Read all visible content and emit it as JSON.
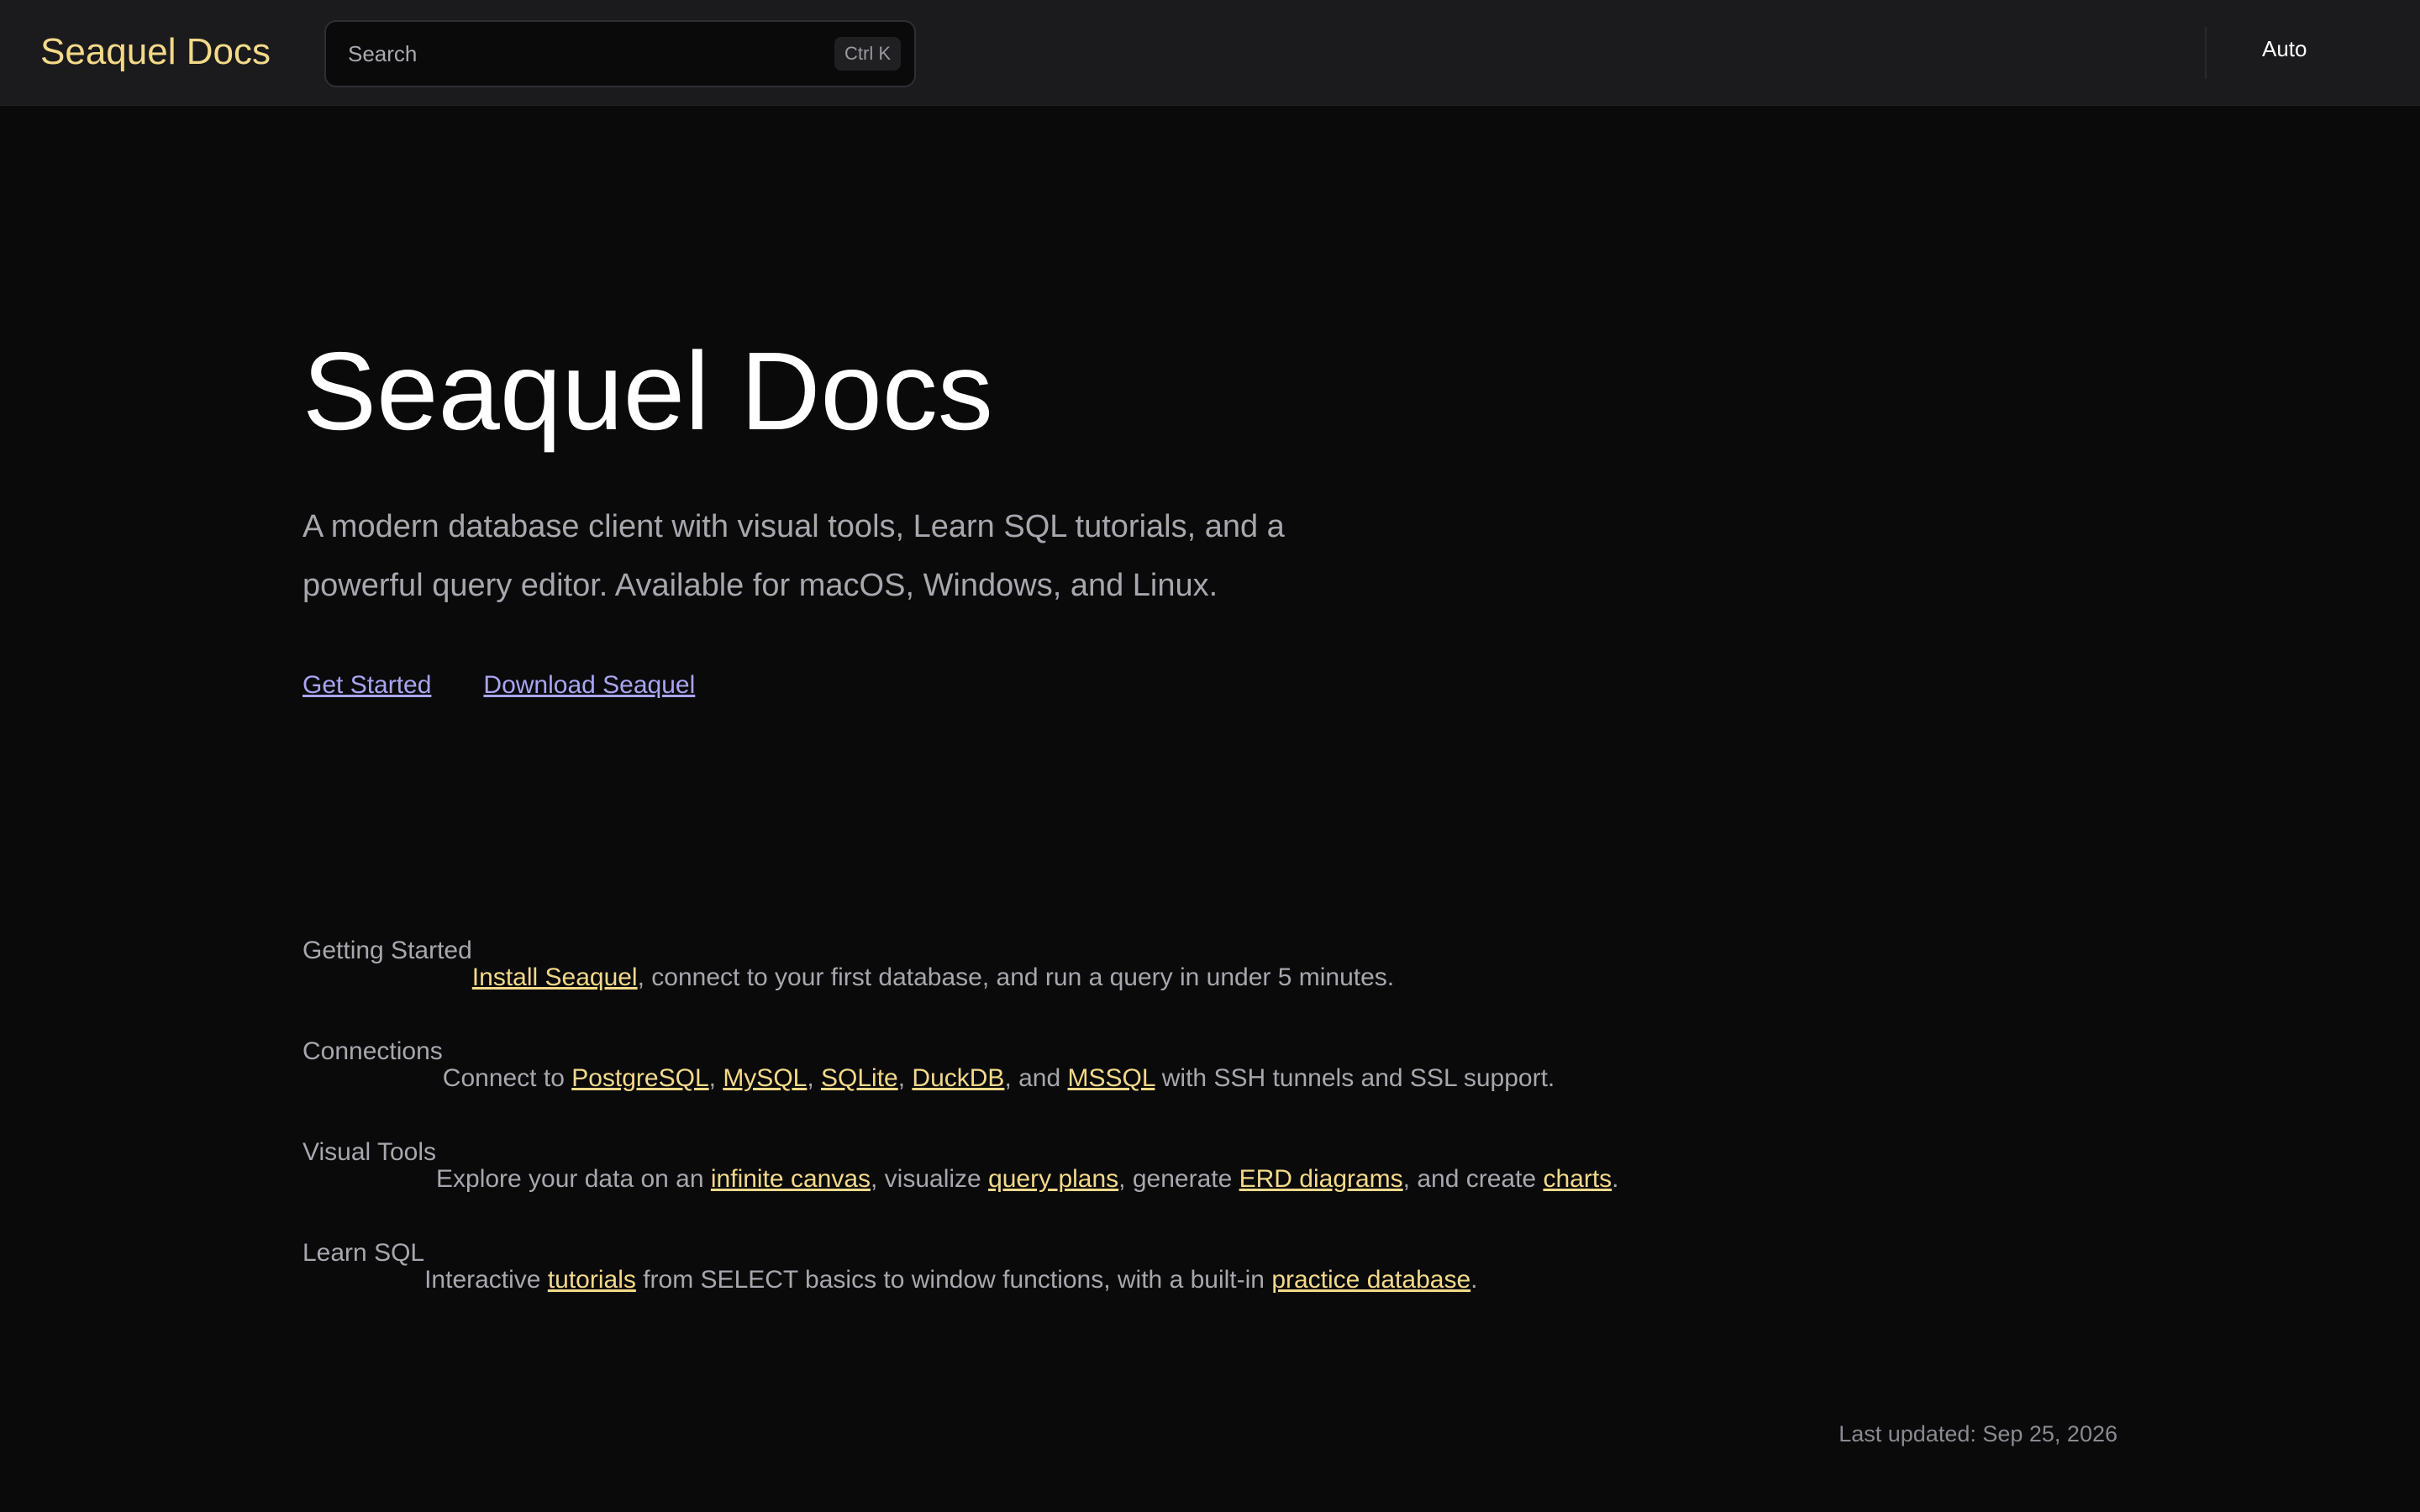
{
  "header": {
    "brand": "Seaquel Docs",
    "search_placeholder": "Search",
    "search_shortcut": "Ctrl K",
    "theme": "Auto"
  },
  "hero": {
    "title": "Seaquel Docs",
    "subtitle": "A modern database client with visual tools, Learn SQL tutorials, and a powerful query editor. Available for macOS, Windows, and Linux.",
    "links": [
      "Get Started",
      "Download Seaquel"
    ]
  },
  "features": [
    {
      "title": "Getting Started",
      "parts": [
        {
          "link": "Install Seaquel"
        },
        {
          "text": ", connect to your first database, and run a query in under 5 minutes."
        }
      ]
    },
    {
      "title": "Connections",
      "parts": [
        {
          "text": "Connect to "
        },
        {
          "link": "PostgreSQL"
        },
        {
          "text": ", "
        },
        {
          "link": "MySQL"
        },
        {
          "text": ", "
        },
        {
          "link": "SQLite"
        },
        {
          "text": ", "
        },
        {
          "link": "DuckDB"
        },
        {
          "text": ", and "
        },
        {
          "link": "MSSQL"
        },
        {
          "text": " with SSH tunnels and SSL support."
        }
      ]
    },
    {
      "title": "Visual Tools",
      "parts": [
        {
          "text": "Explore your data on an "
        },
        {
          "link": "infinite canvas"
        },
        {
          "text": ", visualize "
        },
        {
          "link": "query plans"
        },
        {
          "text": ", generate "
        },
        {
          "link": "ERD diagrams"
        },
        {
          "text": ", and create "
        },
        {
          "link": "charts"
        },
        {
          "text": "."
        }
      ]
    },
    {
      "title": "Learn SQL",
      "parts": [
        {
          "text": "Interactive "
        },
        {
          "link": "tutorials"
        },
        {
          "text": " from SELECT basics to window functions, with a built-in "
        },
        {
          "link": "practice database"
        },
        {
          "text": "."
        }
      ]
    }
  ],
  "footer": {
    "last_updated": "Last updated: Sep 25, 2026"
  },
  "colors": {
    "background": "#0a0a0b",
    "header": "#1b1b1d",
    "brand": "#f4d98a",
    "hero_link": "#a9a5f0",
    "muted_text": "#a7a7ad"
  }
}
